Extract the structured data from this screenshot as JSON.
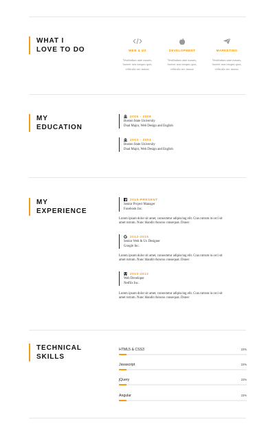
{
  "services_section": {
    "title_line1": "WHAT I",
    "title_line2": "LOVE TO DO",
    "items": [
      {
        "icon": "code-icon",
        "name": "WEB & UX",
        "desc1": "Vestibulum ante mauris,",
        "desc2": "laoreet non tempus quis,",
        "desc3": "vehicula nec massa."
      },
      {
        "icon": "apple-icon",
        "name": "DEVELOPMENT",
        "desc1": "Vestibulum ante mauris,",
        "desc2": "laoreet non tempus quis,",
        "desc3": "vehicula nec massa."
      },
      {
        "icon": "paper-plane-icon",
        "name": "MARKETING",
        "desc1": "Vestibulum ante mauris,",
        "desc2": "laoreet non tempus quis,",
        "desc3": "vehicula nec massa."
      }
    ]
  },
  "education_section": {
    "title_line1": "MY",
    "title_line2": "EDUCATION",
    "items": [
      {
        "icon": "university-icon",
        "date": "2005 - 2008",
        "school": "Boston State University",
        "degree": "Dual Major, Web Design and English"
      },
      {
        "icon": "university-icon",
        "date": "2003 - 2004",
        "school": "Boston State University",
        "degree": "Dual Major, Web Design and English"
      }
    ]
  },
  "experience_section": {
    "title_line1": "MY",
    "title_line2": "EXPERIENCE",
    "items": [
      {
        "icon": "facebook-icon",
        "date": "2015-PRESENT",
        "role": "Senior Project Manager",
        "company": "Facebook Inc.",
        "desc1": "Lorem ipsum dolor sit amet, consectetur adipiscing elit. Cras rutrum in orci sit",
        "desc2": "amet rutrum. Nunc blandit rhoncus consequat. Donec"
      },
      {
        "icon": "google-icon",
        "date": "2012-2015",
        "role": "Senior Web & Ux Designer",
        "company": "Google Inc.",
        "desc1": "Lorem ipsum dolor sit amet, consectetur adipiscing elit. Cras rutrum in orci sit",
        "desc2": "amet rutrum. Nunc blandit rhoncus consequat. Donec"
      },
      {
        "icon": "building-icon",
        "date": "2010-2012",
        "role": "Web Developer",
        "company": "Netflix Inc.",
        "desc1": "Lorem ipsum dolor sit amet, consectetur adipiscing elit. Cras rutrum in orci sit",
        "desc2": "amet rutrum. Nunc blandit rhoncus consequat. Donec"
      }
    ]
  },
  "skills_section": {
    "title_line1": "TECHNICAL",
    "title_line2": "SKILLS",
    "accent_color": "#f39c12",
    "items": [
      {
        "name": "HTML5 & CSS3",
        "percent_label": "22%",
        "level": 0.06
      },
      {
        "name": "Javascript",
        "percent_label": "22%",
        "level": 0.06
      },
      {
        "name": "jQuery",
        "percent_label": "22%",
        "level": 0.06
      },
      {
        "name": "Angular",
        "percent_label": "22%",
        "level": 0.06
      }
    ]
  }
}
